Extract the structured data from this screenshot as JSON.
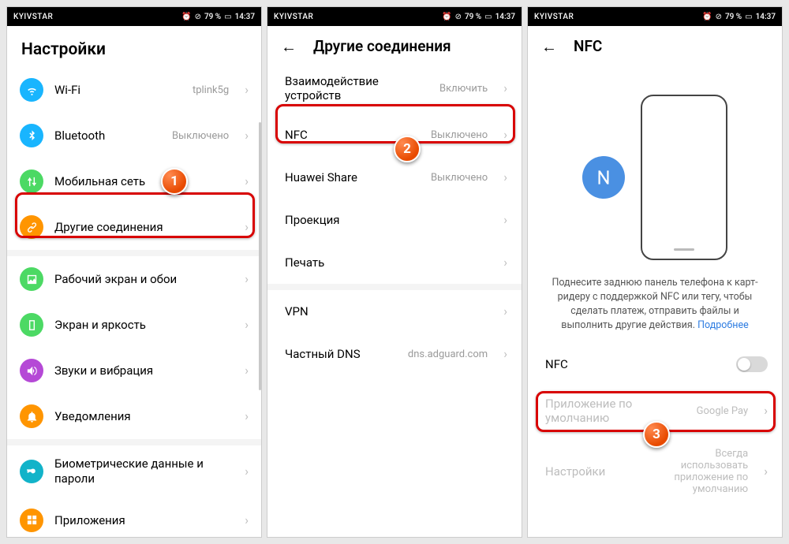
{
  "status": {
    "carrier": "KYIVSTAR",
    "alarm": "⏰",
    "dnd": "⊘",
    "battery_pct": "79 %",
    "time": "14:37"
  },
  "screen1": {
    "title": "Настройки",
    "items": {
      "wifi": {
        "label": "Wi-Fi",
        "value": "tplink5g"
      },
      "bt": {
        "label": "Bluetooth",
        "value": "Выключено"
      },
      "mobile": {
        "label": "Мобильная сеть",
        "value": ""
      },
      "other": {
        "label": "Другие соединения",
        "value": ""
      },
      "wall": {
        "label": "Рабочий экран и обои",
        "value": ""
      },
      "bright": {
        "label": "Экран и яркость",
        "value": ""
      },
      "sound": {
        "label": "Звуки и вибрация",
        "value": ""
      },
      "notif": {
        "label": "Уведомления",
        "value": ""
      },
      "bio": {
        "label": "Биометрические данные и пароли",
        "value": ""
      },
      "apps": {
        "label": "Приложения",
        "value": ""
      }
    }
  },
  "screen2": {
    "title": "Другие соединения",
    "items": {
      "device": {
        "label": "Взаимодействие устройств",
        "value": "Включить"
      },
      "nfc": {
        "label": "NFC",
        "value": "Выключено"
      },
      "hshare": {
        "label": "Huawei Share",
        "value": "Выключено"
      },
      "proj": {
        "label": "Проекция",
        "value": ""
      },
      "print": {
        "label": "Печать",
        "value": ""
      },
      "vpn": {
        "label": "VPN",
        "value": ""
      },
      "dns": {
        "label": "Частный DNS",
        "value": "dns.adguard.com"
      }
    }
  },
  "screen3": {
    "title": "NFC",
    "desc_text": "Поднесите заднюю панель телефона к карт-ридеру с поддержкой NFC или тегу, чтобы сделать платеж, отправить файлы и выполнить другие действия.",
    "desc_link": "Подробнее",
    "items": {
      "nfc": {
        "label": "NFC"
      },
      "defapp": {
        "label": "Приложение по умолчанию",
        "value": "Google Pay"
      },
      "settings": {
        "label": "Настройки",
        "value": "Всегда использовать приложение по умолчанию"
      }
    }
  },
  "callouts": {
    "one": "1",
    "two": "2",
    "three": "3"
  }
}
